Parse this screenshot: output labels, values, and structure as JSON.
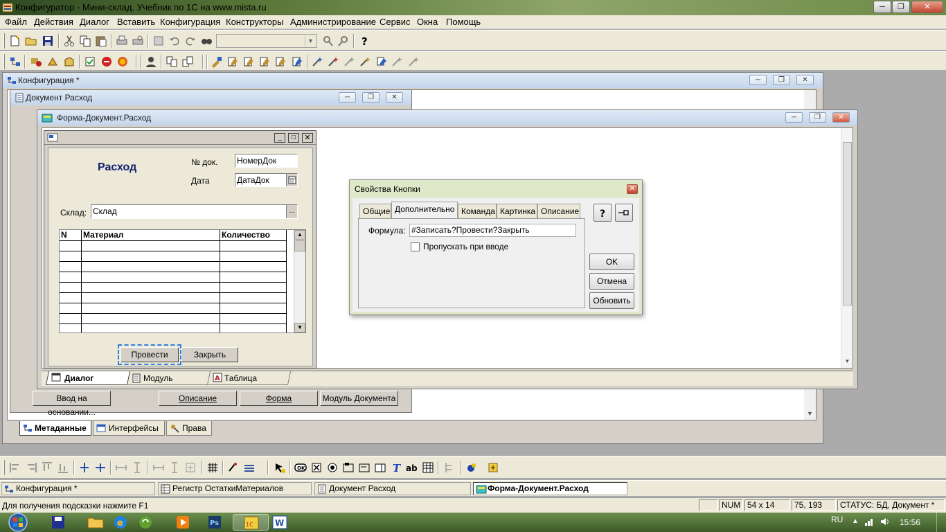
{
  "app": {
    "title": "Конфигуратор - Мини-склад. Учебник по 1С на www.mista.ru"
  },
  "menu": [
    "Файл",
    "Действия",
    "Диалог",
    "Вставить",
    "Конфигурация",
    "Конструкторы",
    "Администрирование",
    "Сервис",
    "Окна",
    "Помощь"
  ],
  "windows": {
    "config": {
      "title": "Конфигурация *"
    },
    "doc": {
      "title": "Документ Расход",
      "buttons": {
        "based_on": "Ввод на основании...",
        "description": "Описание",
        "form": "Форма",
        "module": "Модуль Документа"
      }
    },
    "form": {
      "title": "Форма-Документ.Расход"
    }
  },
  "form_design": {
    "heading": "Расход",
    "docno_label": "№ док.",
    "docno_value": "НомерДок",
    "date_label": "Дата",
    "date_value": "ДатаДок",
    "store_label": "Склад:",
    "store_value": "Склад",
    "table_columns": [
      "N",
      "Материал",
      "Количество"
    ],
    "btn_post": "Провести",
    "btn_close": "Закрыть"
  },
  "form_tabs": [
    "Диалог",
    "Модуль",
    "Таблица"
  ],
  "config_tabs": [
    "Метаданные",
    "Интерфейсы",
    "Права"
  ],
  "dialog": {
    "title": "Свойства Кнопки",
    "tabs": [
      "Общие",
      "Дополнительно",
      "Команда",
      "Картинка",
      "Описание"
    ],
    "active_tab": "Дополнительно",
    "formula_label": "Формула:",
    "formula_value": "#Записать?Провести?Закрыть",
    "skip_label": "Пропускать при вводе",
    "skip_checked": false,
    "ok": "OK",
    "cancel": "Отмена",
    "refresh": "Обновить"
  },
  "mdi_tasks": [
    "Конфигурация *",
    "Регистр ОстаткиМатериалов",
    "Документ Расход",
    "Форма-Документ.Расход"
  ],
  "status": {
    "hint": "Для получения подсказки нажмите F1",
    "num": "NUM",
    "size": "54 x 14",
    "pos": "75, 193",
    "state": "СТАТУС: БД, Документ *"
  },
  "tray": {
    "lang": "RU",
    "time": "15:56"
  }
}
